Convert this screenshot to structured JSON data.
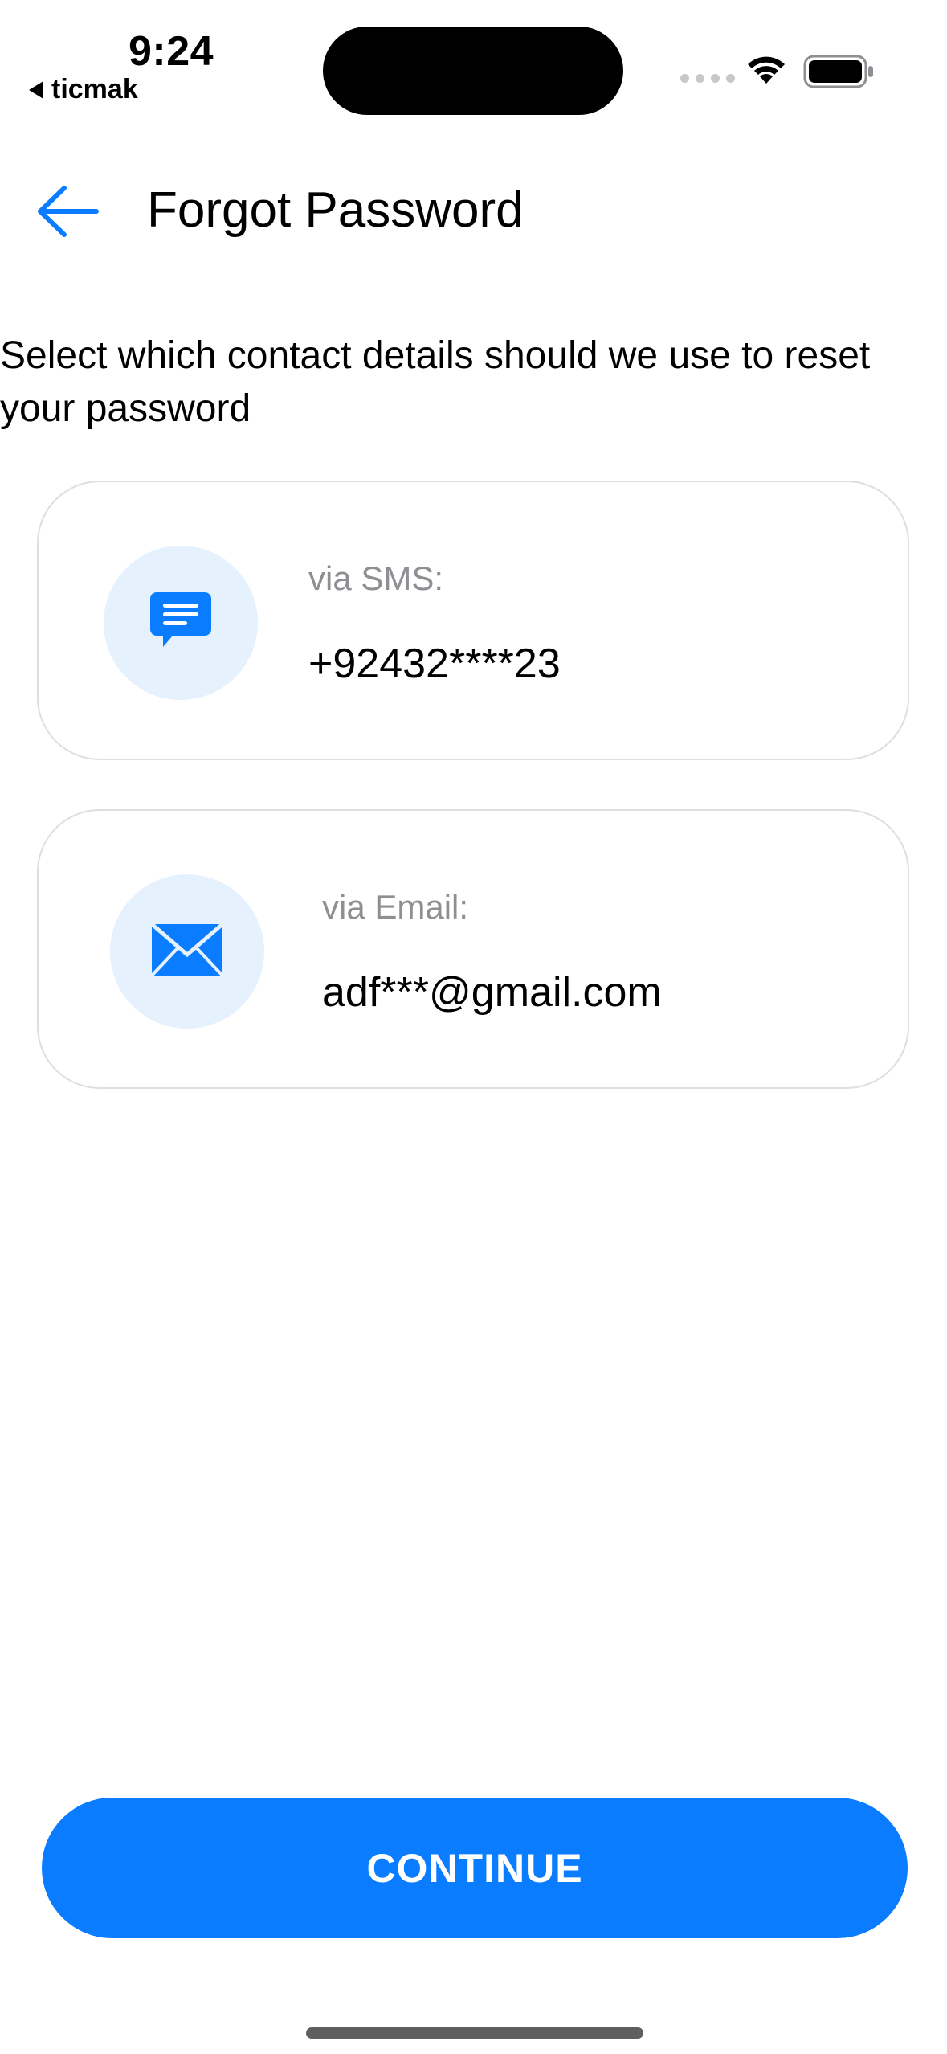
{
  "status_bar": {
    "time": "9:24",
    "back_app": "ticmak"
  },
  "header": {
    "title": "Forgot Password"
  },
  "instruction": "Select which contact details should we use to reset your password",
  "options": [
    {
      "label": "via SMS:",
      "value": "+92432****23",
      "icon": "message-icon"
    },
    {
      "label": "via Email:",
      "value": "adf***@gmail.com",
      "icon": "mail-icon"
    }
  ],
  "continue_label": "CONTINUE",
  "colors": {
    "accent": "#0a7cff",
    "icon_bg": "#e6f1fe",
    "label_gray": "#8e8e93",
    "card_border": "#dedede"
  }
}
